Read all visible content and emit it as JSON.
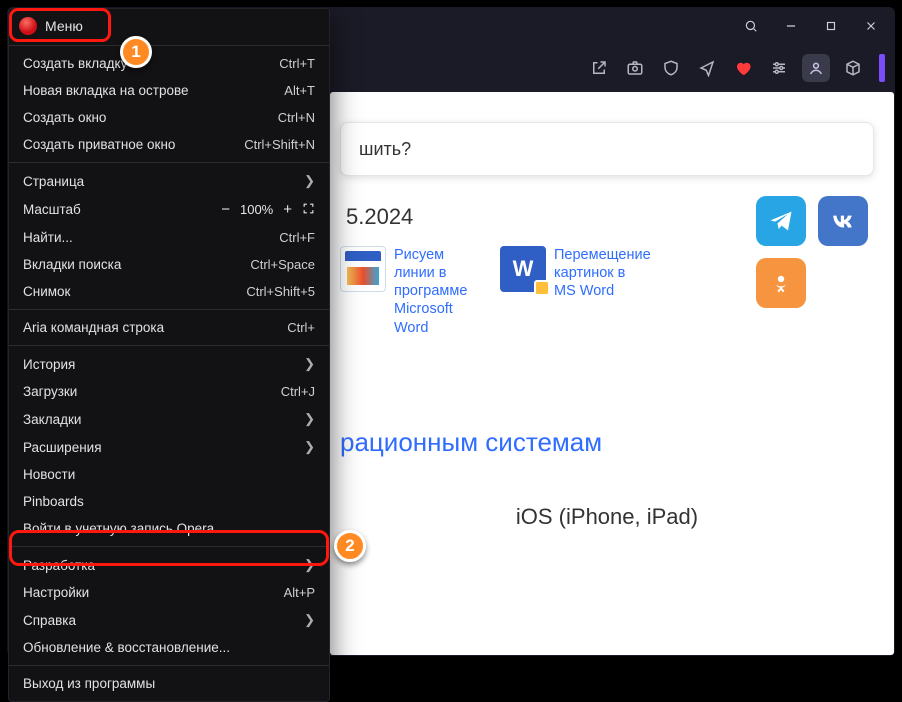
{
  "menu": {
    "title": "Меню",
    "groups": [
      [
        {
          "label": "Создать вкладку",
          "shortcut": "Ctrl+T"
        },
        {
          "label": "Новая вкладка на острове",
          "shortcut": "Alt+T"
        },
        {
          "label": "Создать окно",
          "shortcut": "Ctrl+N"
        },
        {
          "label": "Создать приватное окно",
          "shortcut": "Ctrl+Shift+N"
        }
      ],
      [
        {
          "label": "Страница",
          "submenu": true
        },
        {
          "label": "Масштаб",
          "zoom": "100%"
        },
        {
          "label": "Найти...",
          "shortcut": "Ctrl+F"
        },
        {
          "label": "Вкладки поиска",
          "shortcut": "Ctrl+Space"
        },
        {
          "label": "Снимок",
          "shortcut": "Ctrl+Shift+5"
        }
      ],
      [
        {
          "label": "Aria командная строка",
          "shortcut": "Ctrl+"
        }
      ],
      [
        {
          "label": "История",
          "submenu": true
        },
        {
          "label": "Загрузки",
          "shortcut": "Ctrl+J"
        },
        {
          "label": "Закладки",
          "submenu": true
        },
        {
          "label": "Расширения",
          "submenu": true
        },
        {
          "label": "Новости"
        },
        {
          "label": "Pinboards"
        },
        {
          "label": "Войти в учетную запись Opera..."
        }
      ],
      [
        {
          "label": "Разработка",
          "submenu": true
        },
        {
          "label": "Настройки",
          "shortcut": "Alt+P"
        },
        {
          "label": "Справка",
          "submenu": true
        },
        {
          "label": "Обновление & восстановление..."
        }
      ],
      [
        {
          "label": "Выход из программы"
        }
      ]
    ]
  },
  "page": {
    "search_hint": "шить?",
    "date": "5.2024",
    "card1": "Рисуем линии в программе Microsoft Word",
    "card2": "Перемещение картинок в MS Word",
    "os_title": "рационным системам",
    "os_name": "iOS (iPhone, iPad)"
  },
  "annot": {
    "n1": "1",
    "n2": "2"
  }
}
